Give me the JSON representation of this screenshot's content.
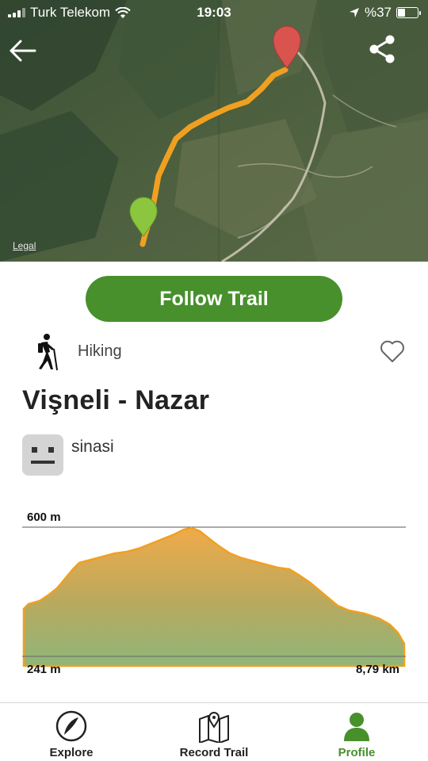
{
  "status_bar": {
    "carrier": "Turk Telekom",
    "time": "19:03",
    "battery": "%37",
    "battery_level": 0.37
  },
  "map": {
    "legal_label": "Legal"
  },
  "actions": {
    "follow_label": "Follow Trail"
  },
  "trail": {
    "activity": "Hiking",
    "title": "Vişneli - Nazar",
    "author": "sinasi"
  },
  "elevation": {
    "max_label": "600 m",
    "min_label": "241 m",
    "distance_label": "8,79 km"
  },
  "tabs": [
    {
      "label": "Explore",
      "icon": "explore-icon",
      "active": false
    },
    {
      "label": "Record Trail",
      "icon": "map-pin-icon",
      "active": false
    },
    {
      "label": "Profile",
      "icon": "profile-icon",
      "active": true
    }
  ],
  "colors": {
    "accent": "#47902c",
    "route": "#f0a020",
    "start_marker": "#8cc63f",
    "end_marker": "#d9534f"
  }
}
